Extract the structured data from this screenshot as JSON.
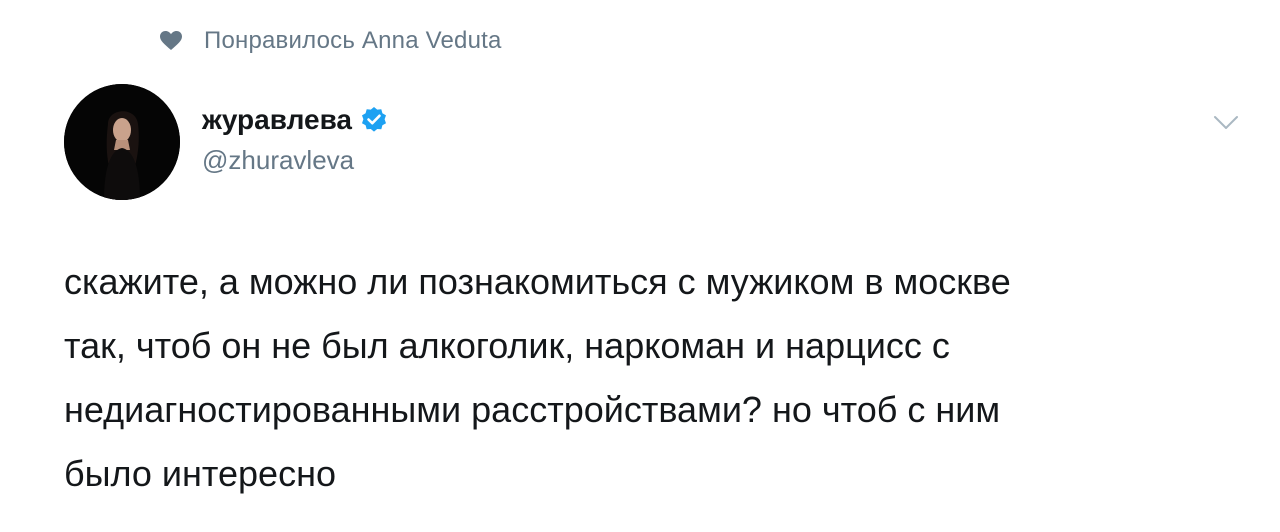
{
  "context": {
    "icon": "heart-icon",
    "text": "Понравилось Anna Veduta",
    "color": "#657786"
  },
  "author": {
    "display_name": "журавлева",
    "verified": true,
    "verified_icon": "verified-badge-icon",
    "verified_color": "#1da1f2",
    "handle": "@zhuravleva",
    "avatar": "avatar"
  },
  "menu": {
    "icon": "chevron-down-icon"
  },
  "tweet": {
    "text": "скажите, а можно ли познакомиться с мужиком в москве\nтак, чтоб он не был алкоголик, наркоман и нарцисс с\nнедиагностированными расстройствами? но чтоб с ним\nбыло интересно"
  }
}
